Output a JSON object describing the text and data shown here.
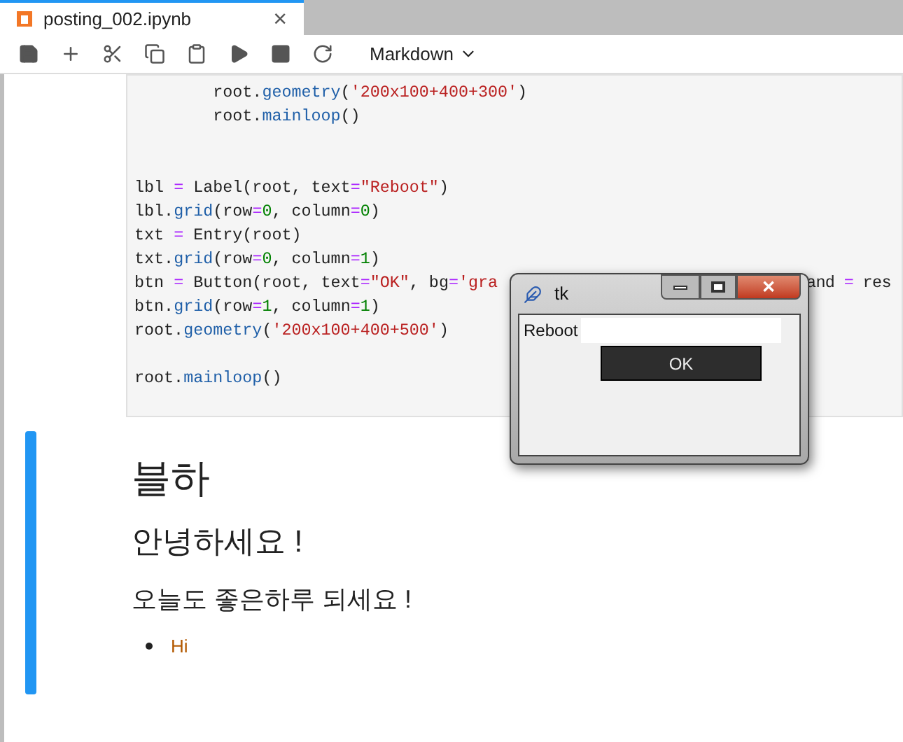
{
  "tab": {
    "title": "posting_002.ipynb",
    "close": "×",
    "selected": true
  },
  "toolbar": {
    "cell_type": "Markdown"
  },
  "code_cell": {
    "lines": [
      {
        "kind": "code",
        "tokens": [
          {
            "kind": "plain",
            "text": "        root."
          },
          {
            "kind": "attr",
            "text": "geometry"
          },
          {
            "kind": "plain",
            "text": "("
          },
          {
            "kind": "string",
            "text": "'200x100+400+300'"
          },
          {
            "kind": "plain",
            "text": ")"
          }
        ]
      },
      {
        "kind": "code",
        "tokens": [
          {
            "kind": "plain",
            "text": "        root."
          },
          {
            "kind": "attr",
            "text": "mainloop"
          },
          {
            "kind": "plain",
            "text": "()"
          }
        ]
      },
      {
        "kind": "blank"
      },
      {
        "kind": "blank"
      },
      {
        "kind": "code",
        "tokens": [
          {
            "kind": "plain",
            "text": "lbl "
          },
          {
            "kind": "op",
            "text": "="
          },
          {
            "kind": "plain",
            "text": " Label(root, text"
          },
          {
            "kind": "op",
            "text": "="
          },
          {
            "kind": "string",
            "text": "\"Reboot\""
          },
          {
            "kind": "plain",
            "text": ")"
          }
        ]
      },
      {
        "kind": "code",
        "tokens": [
          {
            "kind": "plain",
            "text": "lbl."
          },
          {
            "kind": "attr",
            "text": "grid"
          },
          {
            "kind": "plain",
            "text": "(row"
          },
          {
            "kind": "op",
            "text": "="
          },
          {
            "kind": "number",
            "text": "0"
          },
          {
            "kind": "plain",
            "text": ", column"
          },
          {
            "kind": "op",
            "text": "="
          },
          {
            "kind": "number",
            "text": "0"
          },
          {
            "kind": "plain",
            "text": ")"
          }
        ]
      },
      {
        "kind": "code",
        "tokens": [
          {
            "kind": "plain",
            "text": "txt "
          },
          {
            "kind": "op",
            "text": "="
          },
          {
            "kind": "plain",
            "text": " Entry(root)"
          }
        ]
      },
      {
        "kind": "code",
        "tokens": [
          {
            "kind": "plain",
            "text": "txt."
          },
          {
            "kind": "attr",
            "text": "grid"
          },
          {
            "kind": "plain",
            "text": "(row"
          },
          {
            "kind": "op",
            "text": "="
          },
          {
            "kind": "number",
            "text": "0"
          },
          {
            "kind": "plain",
            "text": ", column"
          },
          {
            "kind": "op",
            "text": "="
          },
          {
            "kind": "number",
            "text": "1"
          },
          {
            "kind": "plain",
            "text": ")"
          }
        ]
      },
      {
        "kind": "code",
        "tokens": [
          {
            "kind": "plain",
            "text": "btn "
          },
          {
            "kind": "op",
            "text": "="
          },
          {
            "kind": "plain",
            "text": " Button(root, text"
          },
          {
            "kind": "op",
            "text": "="
          },
          {
            "kind": "string",
            "text": "\"OK\""
          },
          {
            "kind": "plain",
            "text": ", bg"
          },
          {
            "kind": "op",
            "text": "="
          },
          {
            "kind": "string",
            "text": "'gra"
          }
        ],
        "tail": [
          {
            "kind": "plain",
            "text": "and "
          },
          {
            "kind": "op",
            "text": "="
          },
          {
            "kind": "plain",
            "text": " res"
          }
        ]
      },
      {
        "kind": "code",
        "tokens": [
          {
            "kind": "plain",
            "text": "btn."
          },
          {
            "kind": "attr",
            "text": "grid"
          },
          {
            "kind": "plain",
            "text": "(row"
          },
          {
            "kind": "op",
            "text": "="
          },
          {
            "kind": "number",
            "text": "1"
          },
          {
            "kind": "plain",
            "text": ", column"
          },
          {
            "kind": "op",
            "text": "="
          },
          {
            "kind": "number",
            "text": "1"
          },
          {
            "kind": "plain",
            "text": ")"
          }
        ]
      },
      {
        "kind": "code",
        "tokens": [
          {
            "kind": "plain",
            "text": "root."
          },
          {
            "kind": "attr",
            "text": "geometry"
          },
          {
            "kind": "plain",
            "text": "("
          },
          {
            "kind": "string",
            "text": "'200x100+400+500'"
          },
          {
            "kind": "plain",
            "text": ")"
          }
        ]
      },
      {
        "kind": "blank"
      },
      {
        "kind": "code",
        "tokens": [
          {
            "kind": "plain",
            "text": "root."
          },
          {
            "kind": "attr",
            "text": "mainloop"
          },
          {
            "kind": "plain",
            "text": "()"
          }
        ]
      }
    ]
  },
  "tk_window": {
    "title": "tk",
    "label": "Reboot",
    "button": "OK",
    "close": "✕"
  },
  "markdown_cell": {
    "selected": true,
    "h1": "블하",
    "h2": "안녕하세요 !",
    "h3": "오늘도 좋은하루 되세요 !",
    "list": [
      "Hi"
    ]
  }
}
